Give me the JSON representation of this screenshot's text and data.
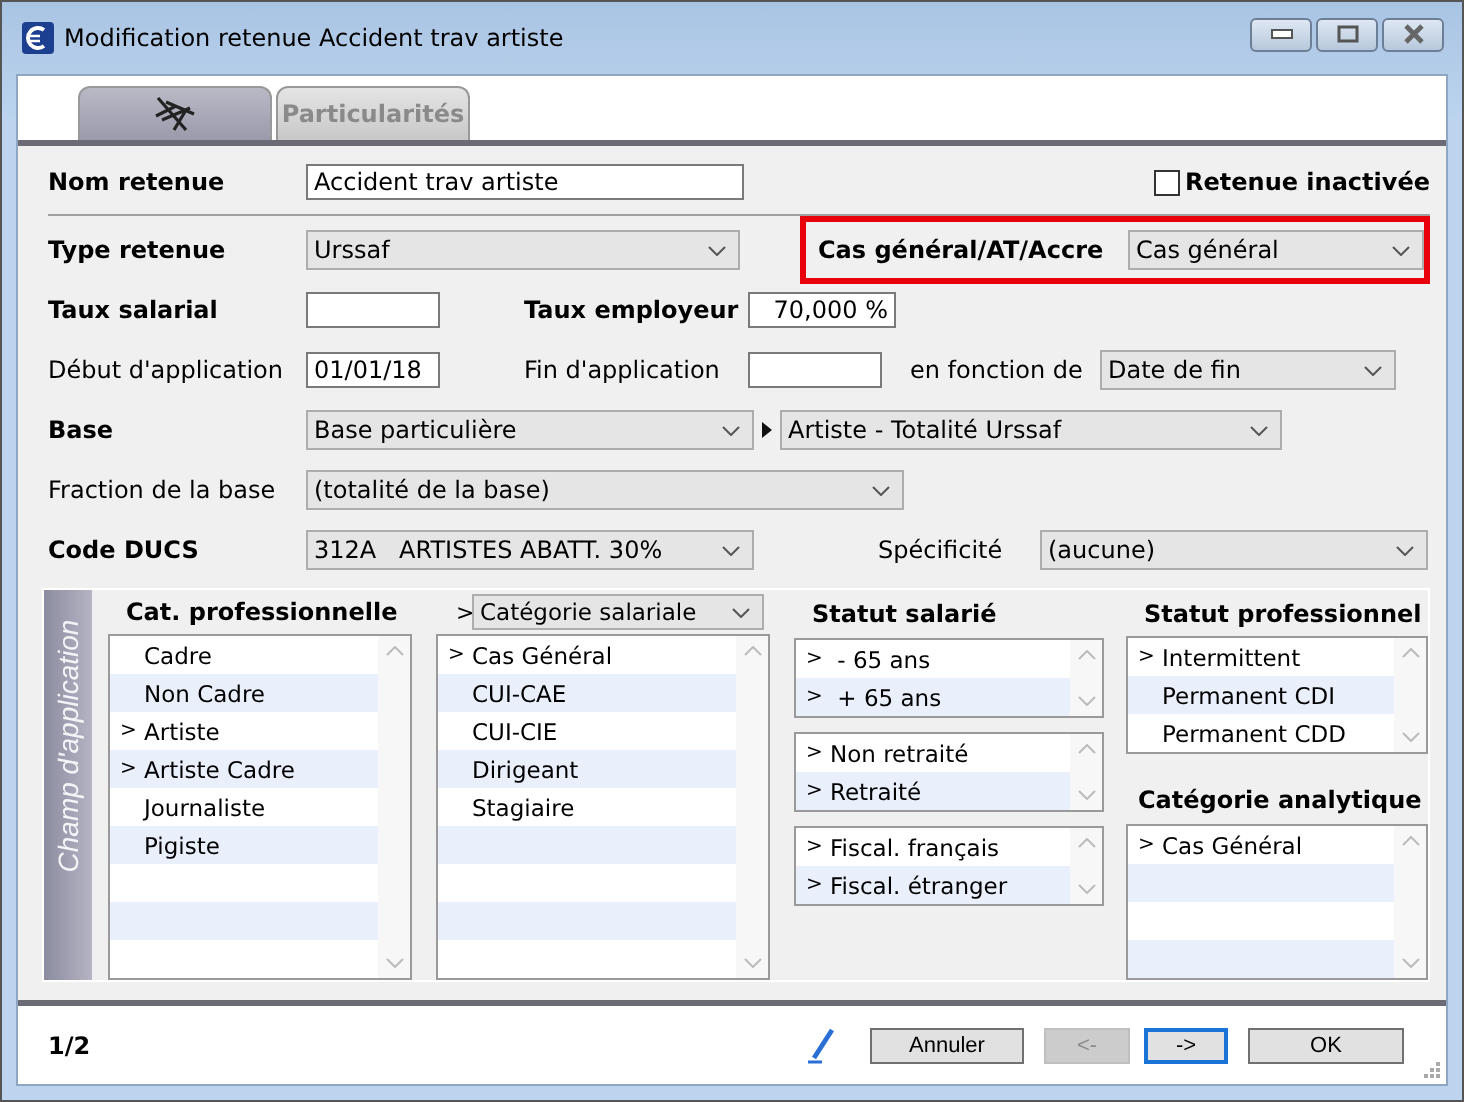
{
  "window": {
    "title": "Modification retenue Accident trav artiste"
  },
  "tabs": [
    {
      "kind": "icon",
      "selected": true
    },
    {
      "kind": "text",
      "label": "Particularités",
      "selected": false
    }
  ],
  "form": {
    "nom": {
      "label": "Nom retenue",
      "value": "Accident trav artiste"
    },
    "inactive": {
      "label": "Retenue inactivée",
      "checked": false
    },
    "type": {
      "label": "Type retenue",
      "value": "Urssaf"
    },
    "cas": {
      "label": "Cas général/AT/Accre",
      "value": "Cas général"
    },
    "taux_salarial": {
      "label": "Taux salarial"
    },
    "taux_employeur": {
      "label": "Taux employeur",
      "value": "70,000 %"
    },
    "debut": {
      "label": "Début d'application",
      "value": "01/01/18"
    },
    "fin": {
      "label": "Fin d'application"
    },
    "fonction": {
      "label": "en fonction de",
      "value": "Date de fin"
    },
    "base": {
      "label": "Base",
      "value": "Base particulière",
      "detail": "Artiste - Totalité Urssaf"
    },
    "fraction": {
      "label": "Fraction de la base",
      "value": "(totalité de la base)"
    },
    "ducs": {
      "label": "Code DUCS",
      "value": "312A   ARTISTES ABATT. 30%"
    },
    "specificite": {
      "label": "Spécificité",
      "value": "(aucune)"
    }
  },
  "scope": {
    "title": "Champ d'application",
    "cat_pro": {
      "header": "Cat. professionnelle",
      "items": [
        {
          "label": "Cadre"
        },
        {
          "label": "Non Cadre"
        },
        {
          "marker": ">",
          "label": "Artiste"
        },
        {
          "marker": ">",
          "label": "Artiste Cadre"
        },
        {
          "label": "Journaliste"
        },
        {
          "label": "Pigiste"
        }
      ]
    },
    "cat_sal": {
      "marker": ">",
      "value": "Catégorie salariale",
      "items": [
        {
          "marker": ">",
          "label": "Cas Général"
        },
        {
          "label": "CUI-CAE"
        },
        {
          "label": "CUI-CIE"
        },
        {
          "label": "Dirigeant"
        },
        {
          "label": "Stagiaire"
        }
      ]
    },
    "statut_salarie": {
      "header": "Statut salarié",
      "lists": [
        [
          {
            "marker": ">",
            "label": " - 65 ans"
          },
          {
            "marker": ">",
            "label": " + 65 ans"
          }
        ],
        [
          {
            "marker": ">",
            "label": "Non retraité"
          },
          {
            "marker": ">",
            "label": "Retraité"
          }
        ],
        [
          {
            "marker": ">",
            "label": "Fiscal. français"
          },
          {
            "marker": ">",
            "label": "Fiscal. étranger"
          }
        ]
      ]
    },
    "statut_pro": {
      "header": "Statut professionnel",
      "items": [
        {
          "marker": ">",
          "label": "Intermittent"
        },
        {
          "label": "Permanent CDI"
        },
        {
          "label": "Permanent CDD"
        }
      ]
    },
    "cat_ana": {
      "header": "Catégorie analytique",
      "items": [
        {
          "marker": ">",
          "label": "Cas Général"
        }
      ]
    }
  },
  "footer": {
    "page": "1/2",
    "buttons": [
      {
        "label": "Annuler",
        "disabled": false,
        "focused": false
      },
      {
        "label": "<-",
        "disabled": true,
        "focused": false
      },
      {
        "label": "->",
        "disabled": false,
        "focused": true
      },
      {
        "label": "OK",
        "disabled": false,
        "focused": false
      }
    ]
  }
}
